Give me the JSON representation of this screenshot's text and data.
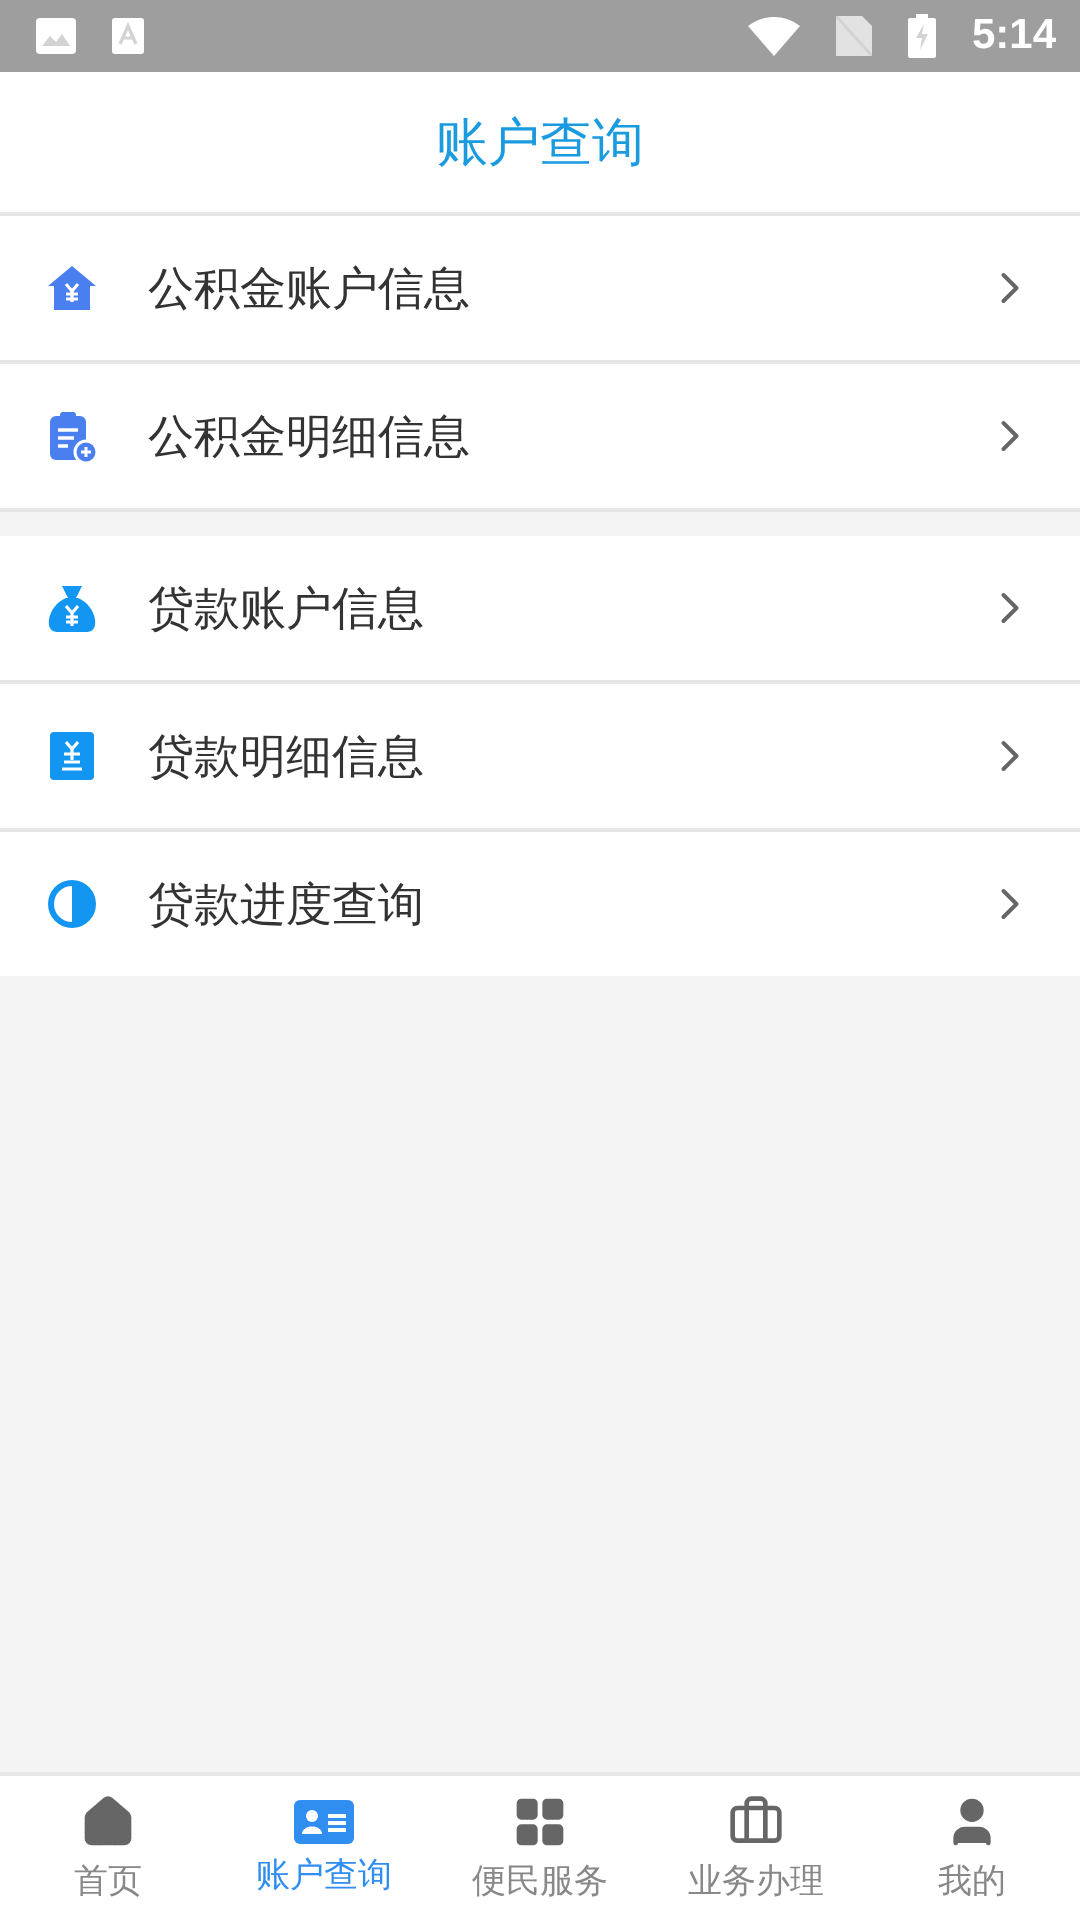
{
  "status_bar": {
    "time": "5:14"
  },
  "header": {
    "title": "账户查询"
  },
  "groups": [
    {
      "items": [
        {
          "label": "公积金账户信息"
        },
        {
          "label": "公积金明细信息"
        }
      ]
    },
    {
      "items": [
        {
          "label": "贷款账户信息"
        },
        {
          "label": "贷款明细信息"
        },
        {
          "label": "贷款进度查询"
        }
      ]
    }
  ],
  "bottom_nav": [
    {
      "label": "首页",
      "selected": false
    },
    {
      "label": "账户查询",
      "selected": true
    },
    {
      "label": "便民服务",
      "selected": false
    },
    {
      "label": "业务办理",
      "selected": false
    },
    {
      "label": "我的",
      "selected": false
    }
  ]
}
